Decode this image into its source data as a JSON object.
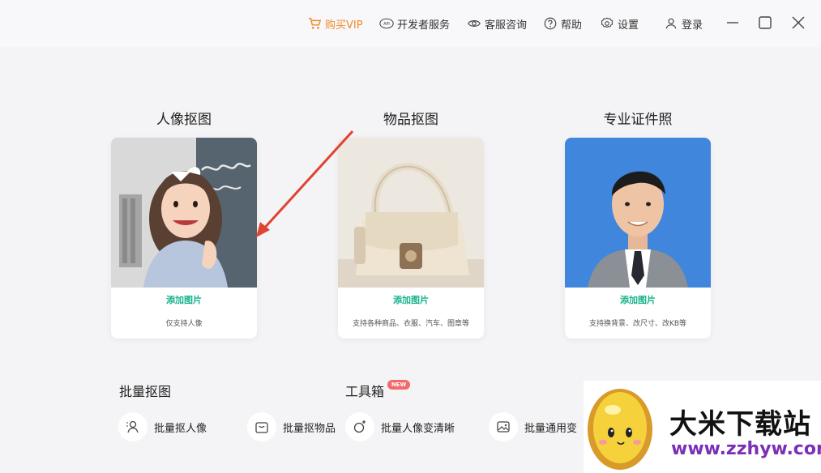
{
  "header": {
    "vip_label": "购买VIP",
    "dev_label": "开发者服务",
    "service_label": "客服咨询",
    "help_label": "帮助",
    "settings_label": "设置",
    "login_label": "登录",
    "api_badge": "API"
  },
  "cards": [
    {
      "title": "人像抠图",
      "add_label": "添加图片",
      "hint": "仅支持人像"
    },
    {
      "title": "物品抠图",
      "add_label": "添加图片",
      "hint": "支持各种商品、衣服、汽车、图章等"
    },
    {
      "title": "专业证件照",
      "add_label": "添加图片",
      "hint": "支持换背景、改尺寸、改KB等"
    }
  ],
  "sections": {
    "batch_title": "批量抠图",
    "toolbox_title": "工具箱",
    "new_badge": "NEW"
  },
  "tools": [
    {
      "label": "批量抠人像",
      "icon": "person-icon"
    },
    {
      "label": "批量抠物品",
      "icon": "bag-icon"
    },
    {
      "label": "批量人像变清晰",
      "icon": "enhance-icon"
    },
    {
      "label": "批量通用变",
      "icon": "image-icon"
    }
  ],
  "watermark": {
    "title": "大米下载站",
    "url": "www.zzhyw.com"
  },
  "colors": {
    "accent_green": "#14b38a",
    "vip_orange": "#f0892a",
    "arrow_red": "#e0432f",
    "id_photo_blue": "#3f86dc"
  }
}
